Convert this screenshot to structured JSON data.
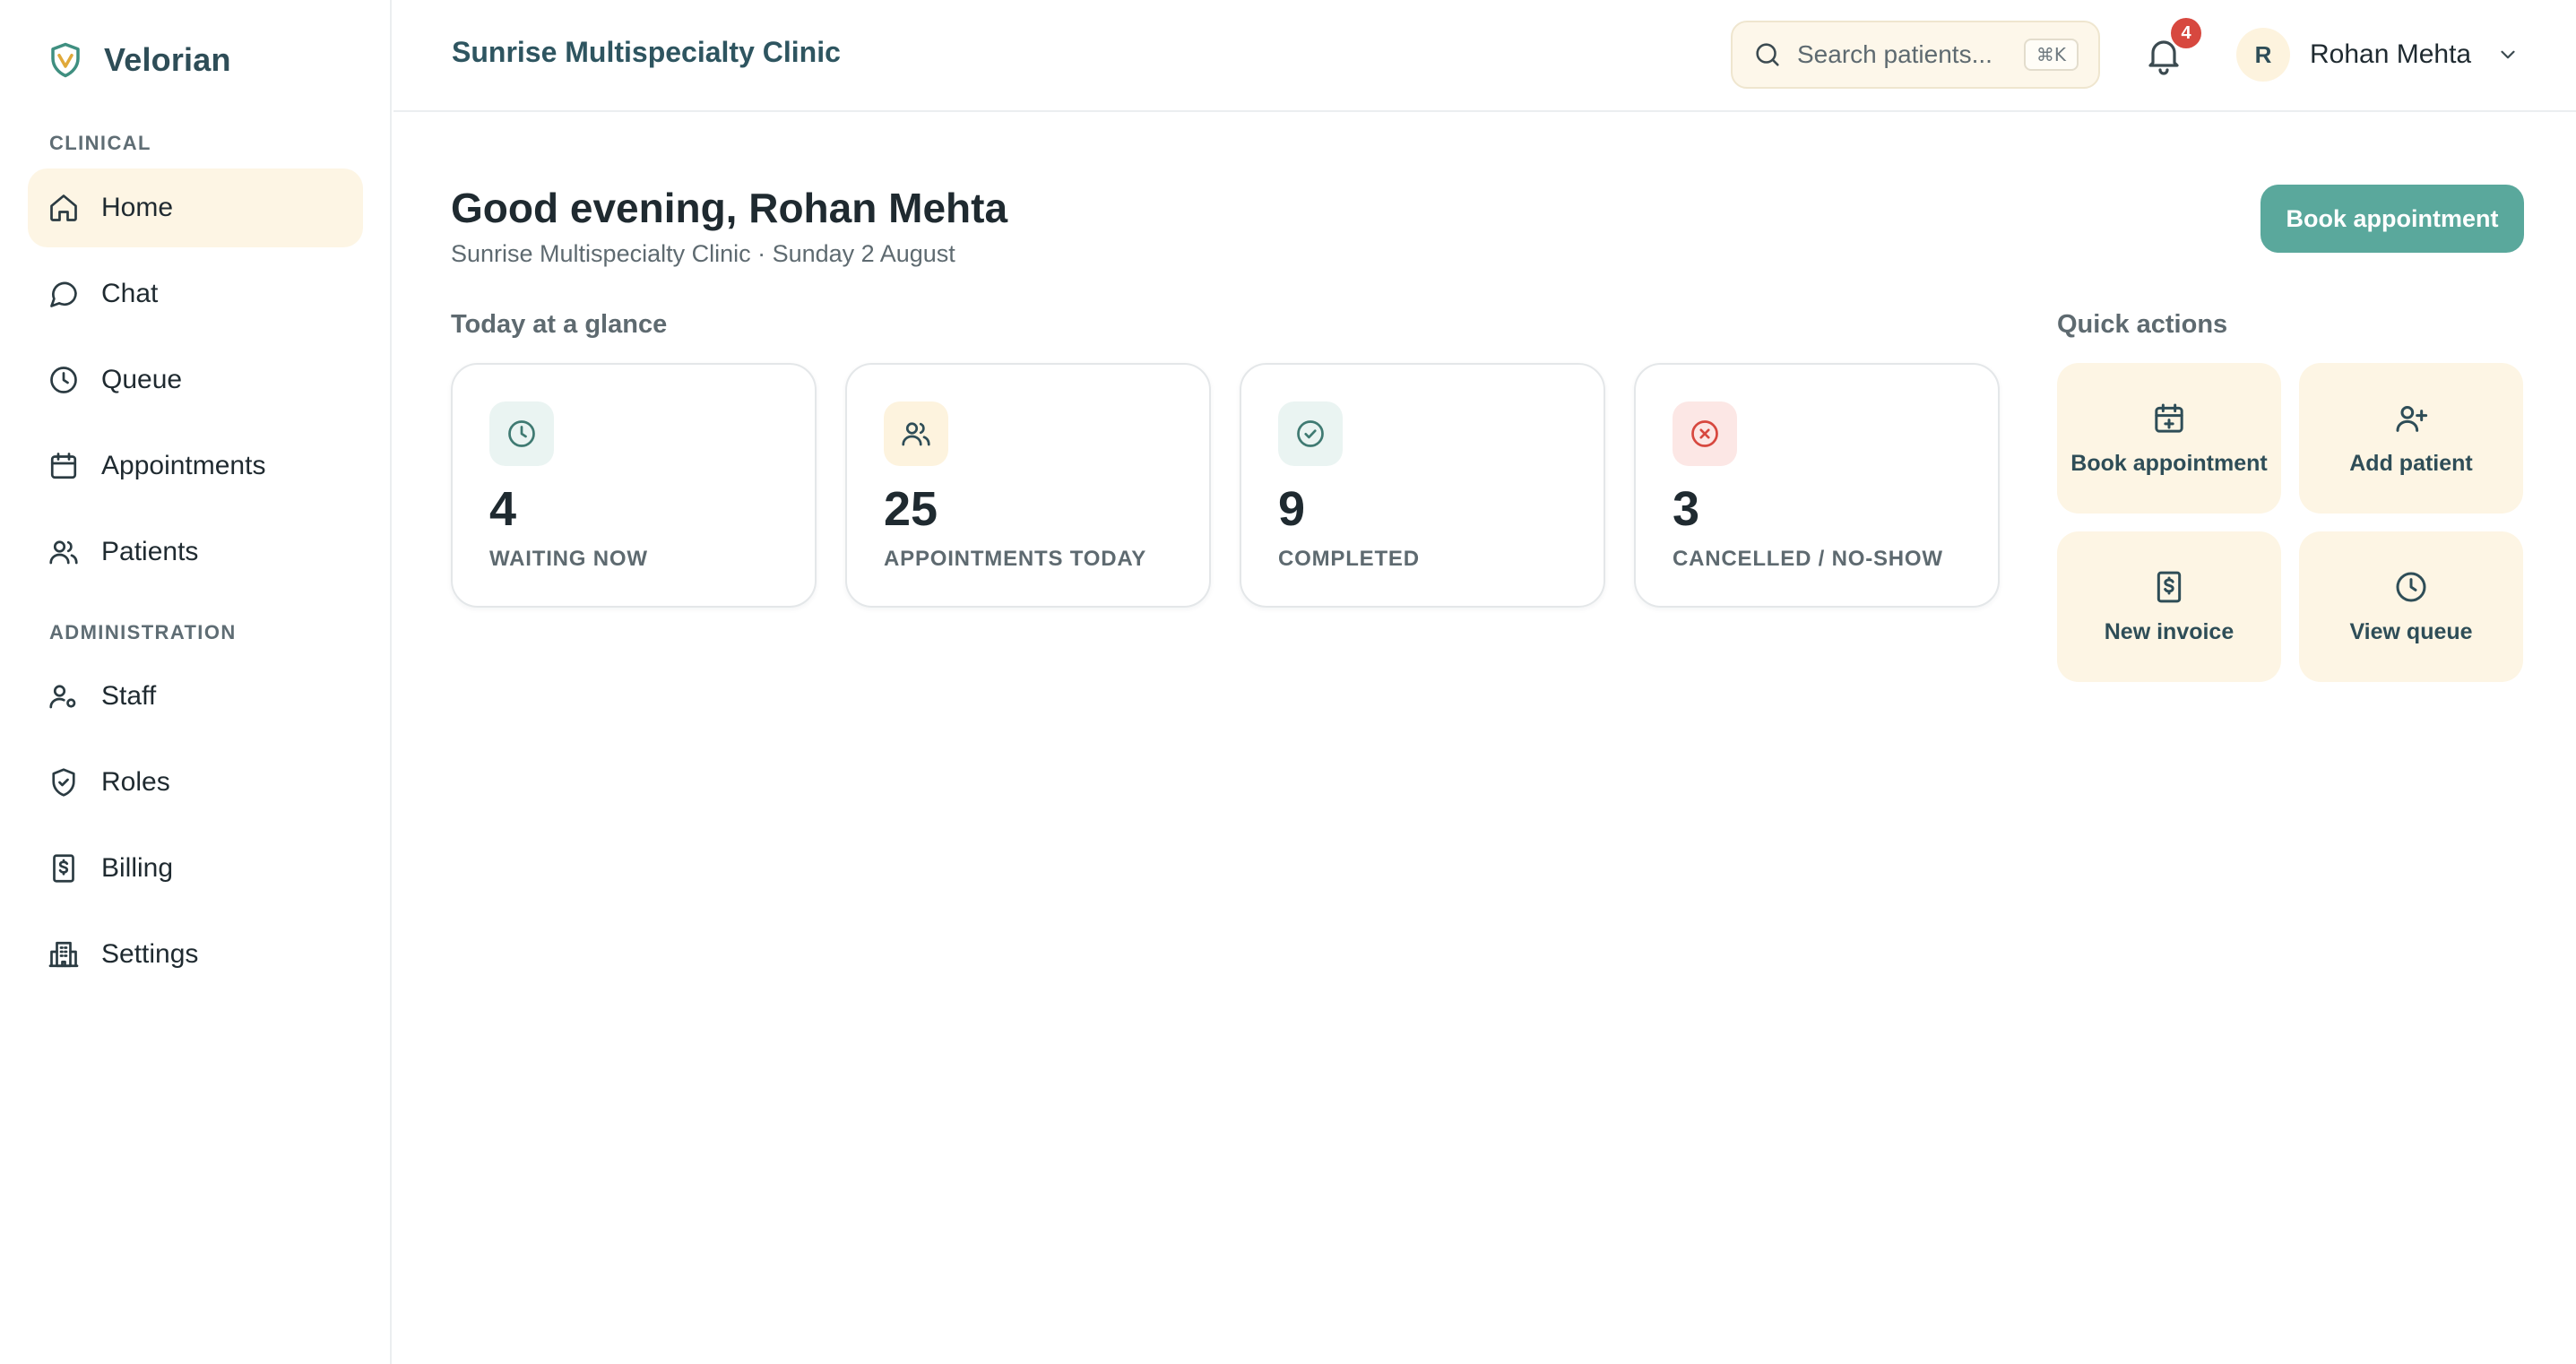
{
  "brand": {
    "name": "Velorian"
  },
  "sidebar": {
    "sections": [
      {
        "label": "CLINICAL"
      },
      {
        "label": "ADMINISTRATION"
      }
    ],
    "items": [
      {
        "label": "Home",
        "icon": "home-icon"
      },
      {
        "label": "Chat",
        "icon": "chat-icon"
      },
      {
        "label": "Queue",
        "icon": "clock-icon"
      },
      {
        "label": "Appointments",
        "icon": "calendar-icon"
      },
      {
        "label": "Patients",
        "icon": "users-icon"
      },
      {
        "label": "Staff",
        "icon": "user-cog-icon"
      },
      {
        "label": "Roles",
        "icon": "shield-icon"
      },
      {
        "label": "Billing",
        "icon": "receipt-icon"
      },
      {
        "label": "Settings",
        "icon": "building-icon"
      }
    ],
    "active_item": "Home"
  },
  "header": {
    "clinic_title": "Sunrise Multispecialty Clinic",
    "search": {
      "placeholder": "Search patients...",
      "shortcut": "⌘K"
    },
    "notifications": {
      "count": "4"
    },
    "user": {
      "initial": "R",
      "name": "Rohan Mehta"
    }
  },
  "main": {
    "greeting": "Good evening, Rohan Mehta",
    "subline": "Sunrise Multispecialty Clinic · Sunday 2 August",
    "primary_button": "Book appointment",
    "glance_title": "Today at a glance",
    "stats": [
      {
        "value": "4",
        "label": "WAITING NOW",
        "icon": "clock-icon",
        "tint": "#eaf4f2",
        "icon_color": "#3f7a72"
      },
      {
        "value": "25",
        "label": "APPOINTMENTS TODAY",
        "icon": "users-icon",
        "tint": "#fdf3de",
        "icon_color": "#2e4d57"
      },
      {
        "value": "9",
        "label": "COMPLETED",
        "icon": "check-circle-icon",
        "tint": "#eaf4f2",
        "icon_color": "#3f7a72"
      },
      {
        "value": "3",
        "label": "CANCELLED / NO-SHOW",
        "icon": "x-circle-icon",
        "tint": "#fce7e5",
        "icon_color": "#d7483f"
      }
    ],
    "quick_actions_title": "Quick actions",
    "quick_actions": [
      {
        "label": "Book appointment",
        "icon": "calendar-plus-icon"
      },
      {
        "label": "Add patient",
        "icon": "user-plus-icon"
      },
      {
        "label": "New invoice",
        "icon": "receipt-icon"
      },
      {
        "label": "View queue",
        "icon": "clock-icon"
      }
    ]
  },
  "colors": {
    "accent": "#5aa89c",
    "brand_text": "#2e4d57",
    "active_nav_bg": "#fdf5e4",
    "badge": "#d7483f"
  }
}
